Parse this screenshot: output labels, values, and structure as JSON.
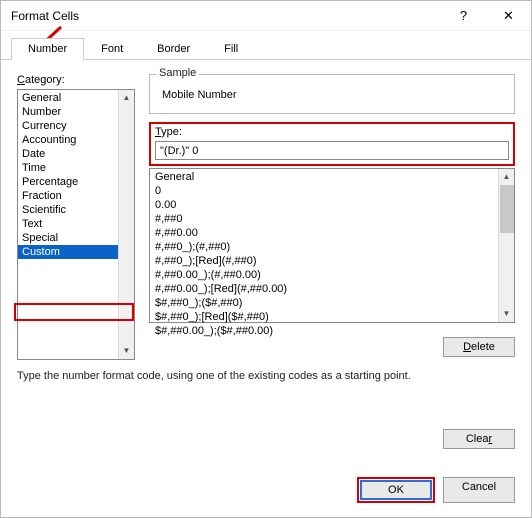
{
  "dialog": {
    "title": "Format Cells",
    "help_icon": "?",
    "close_icon": "✕"
  },
  "tabs": {
    "number": "Number",
    "font": "Font",
    "border": "Border",
    "fill": "Fill"
  },
  "category": {
    "label": "Category:",
    "items": [
      "General",
      "Number",
      "Currency",
      "Accounting",
      "Date",
      "Time",
      "Percentage",
      "Fraction",
      "Scientific",
      "Text",
      "Special",
      "Custom"
    ],
    "selected_index": 11
  },
  "sample": {
    "label": "Sample",
    "value": "Mobile Number"
  },
  "type": {
    "label": "Type:",
    "value": "\"(Dr.)\" 0 "
  },
  "format_list": [
    "General",
    "0",
    "0.00",
    "#,##0",
    "#,##0.00",
    "#,##0_);(#,##0)",
    "#,##0_);[Red](#,##0)",
    "#,##0.00_);(#,##0.00)",
    "#,##0.00_);[Red](#,##0.00)",
    "$#,##0_);($#,##0)",
    "$#,##0_);[Red]($#,##0)",
    "$#,##0.00_);($#,##0.00)"
  ],
  "buttons": {
    "delete": "Delete",
    "clear": "Clear",
    "ok": "OK",
    "cancel": "Cancel"
  },
  "hint": "Type the number format code, using one of the existing codes as a starting point."
}
